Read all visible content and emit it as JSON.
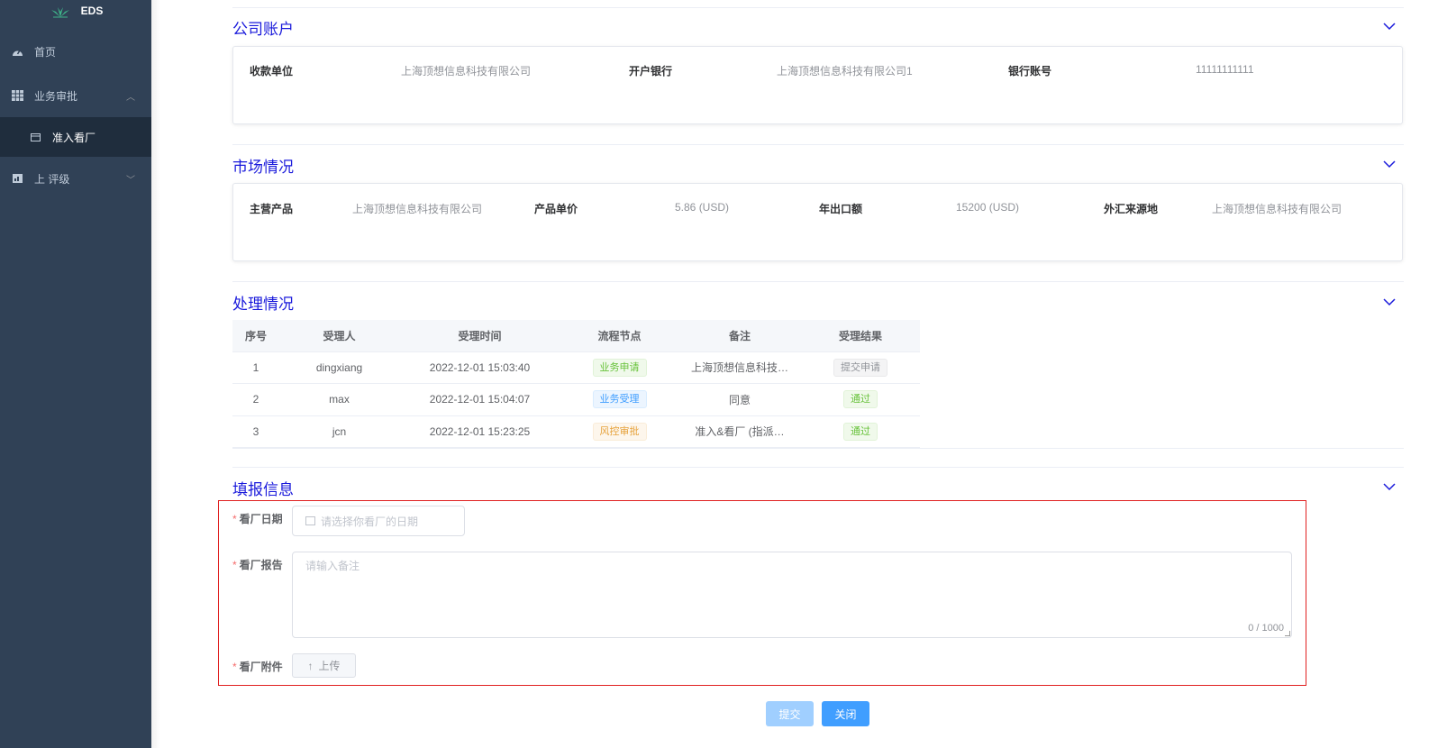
{
  "app": {
    "logo_text": "EDS"
  },
  "sidebar": {
    "items": [
      {
        "label": "首页",
        "icon": "dashboard-icon"
      },
      {
        "label": "业务审批",
        "icon": "grid-icon"
      },
      {
        "label": "准入看厂",
        "icon": "calendar-icon"
      },
      {
        "label": "上 评级",
        "icon": "chart-icon"
      }
    ]
  },
  "company_account": {
    "title": "公司账户",
    "fields": [
      {
        "label": "收款单位",
        "value": "上海顶想信息科技有限公司"
      },
      {
        "label": "开户银行",
        "value": "上海顶想信息科技有限公司1"
      },
      {
        "label": "银行账号",
        "value": "11111111111"
      }
    ]
  },
  "market": {
    "title": "市场情况",
    "fields": [
      {
        "label": "主营产品",
        "value": "上海顶想信息科技有限公司"
      },
      {
        "label": "产品单价",
        "value": "5.86 (USD)"
      },
      {
        "label": "年出口额",
        "value": "15200 (USD)"
      },
      {
        "label": "外汇来源地",
        "value": "上海顶想信息科技有限公司"
      }
    ]
  },
  "processing": {
    "title": "处理情况",
    "columns": [
      "序号",
      "受理人",
      "受理时间",
      "流程节点",
      "备注",
      "受理结果"
    ],
    "rows": [
      {
        "no": "1",
        "handler": "dingxiang",
        "time": "2022-12-01 15:03:40",
        "node": "业务申请",
        "remark": "上海顶想信息科技…",
        "result": "提交申请"
      },
      {
        "no": "2",
        "handler": "max",
        "time": "2022-12-01 15:04:07",
        "node": "业务受理",
        "remark": "同意",
        "result": "通过"
      },
      {
        "no": "3",
        "handler": "jcn",
        "time": "2022-12-01 15:23:25",
        "node": "风控审批",
        "remark": "准入&看厂 (指派…",
        "result": "通过"
      }
    ]
  },
  "report": {
    "title": "填报信息",
    "date_label": "看厂日期",
    "date_placeholder": "请选择你看厂的日期",
    "report_label": "看厂报告",
    "report_placeholder": "请输入备注",
    "report_count": "0 / 1000",
    "attachment_label": "看厂附件",
    "upload_label": "上传"
  },
  "actions": {
    "submit": "提交",
    "close": "关闭"
  },
  "colors": {
    "sidebar_bg": "#304156",
    "section_title": "#1a1adb",
    "primary": "#409eff",
    "error_border": "#e02020"
  }
}
